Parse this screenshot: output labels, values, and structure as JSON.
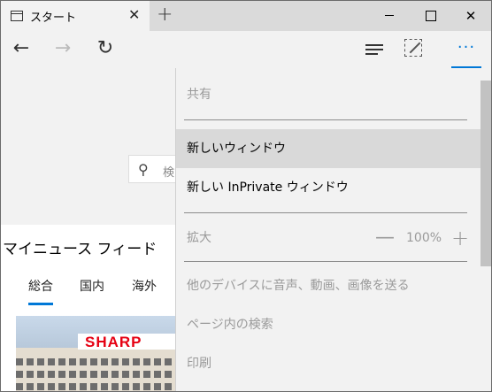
{
  "tab": {
    "title": "スタート",
    "close": "✕",
    "new_tab": "+"
  },
  "window_controls": {
    "close": "✕"
  },
  "nav": {
    "back": "←",
    "forward": "→",
    "refresh": "↻",
    "more": "···"
  },
  "page": {
    "search_icon": "⚲",
    "search_placeholder": "検",
    "feed_title": "マイニュース フィード",
    "feed_tabs": [
      {
        "label": "総合",
        "active": true
      },
      {
        "label": "国内",
        "active": false
      },
      {
        "label": "海外",
        "active": false
      }
    ],
    "image_sign": "SHARP"
  },
  "menu": {
    "share": "共有",
    "new_window": "新しいウィンドウ",
    "new_inprivate": "新しい InPrivate ウィンドウ",
    "zoom_label": "拡大",
    "zoom_minus": "—",
    "zoom_value": "100%",
    "zoom_plus": "+",
    "cast": "他のデバイスに音声、動画、画像を送る",
    "find": "ページ内の検索",
    "print": "印刷"
  },
  "colors": {
    "accent": "#0078d7",
    "menu_bg": "#f2f2f2",
    "hover": "#d9d9d9",
    "disabled_text": "#9a9a9a"
  }
}
